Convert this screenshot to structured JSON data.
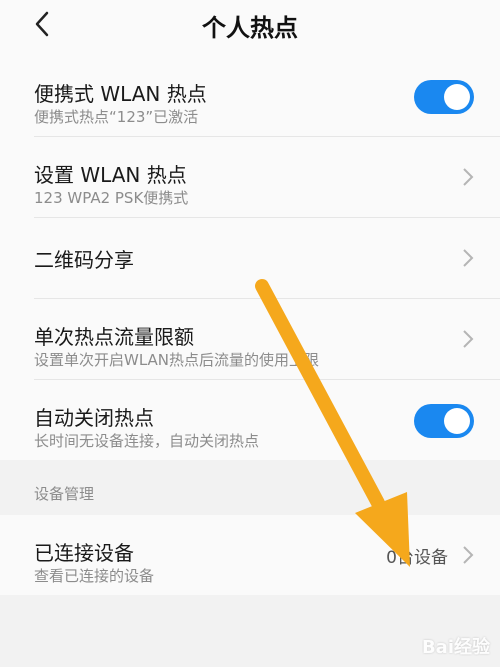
{
  "header": {
    "title": "个人热点",
    "back_icon": "chevron-left-icon"
  },
  "settings": [
    {
      "label": "便携式 WLAN 热点",
      "sub": "便携式热点“123”已激活",
      "control": "toggle",
      "on": true
    },
    {
      "label": "设置 WLAN 热点",
      "sub": "123 WPA2 PSK便携式",
      "control": "chevron"
    },
    {
      "label": "二维码分享",
      "control": "chevron"
    },
    {
      "label": "单次热点流量限额",
      "sub": "设置单次开启WLAN热点后流量的使用上限",
      "control": "chevron"
    },
    {
      "label": "自动关闭热点",
      "sub": "长时间无设备连接，自动关闭热点",
      "control": "toggle",
      "on": true
    }
  ],
  "device_section": {
    "title": "设备管理",
    "item": {
      "label": "已连接设备",
      "sub": "查看已连接的设备",
      "value": "0台设备"
    }
  },
  "colors": {
    "accent": "#1a88f0",
    "annotation_arrow": "#f5a81c"
  },
  "watermark": "Bai经验"
}
